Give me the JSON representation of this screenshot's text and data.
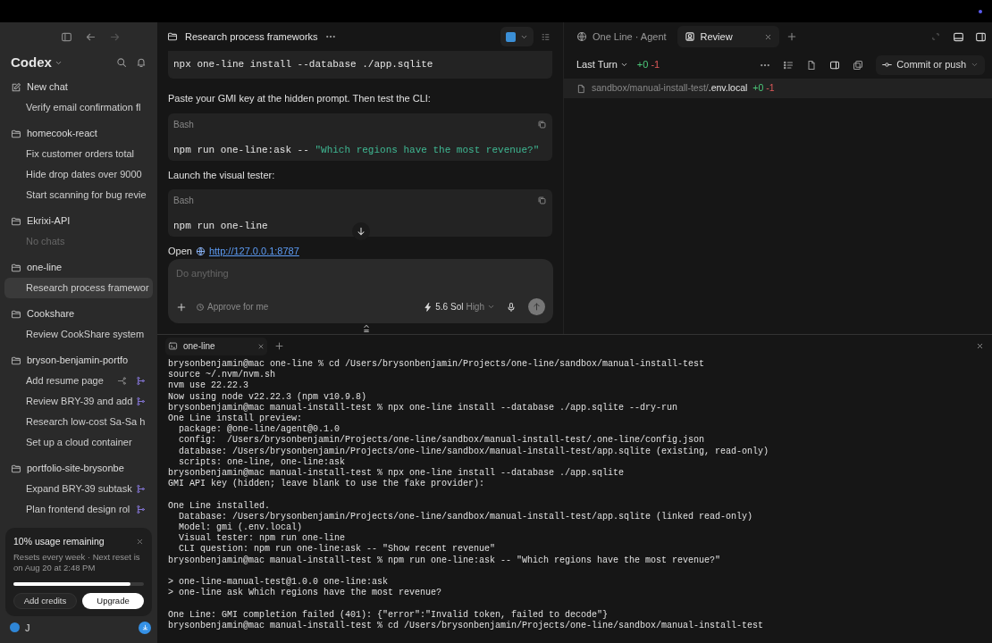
{
  "sidebar": {
    "app_title": "Codex",
    "new_chat": "New chat",
    "loose_chats": [
      {
        "title": "Verify email confirmation fl",
        "selected": false,
        "worktree": false
      }
    ],
    "projects": [
      {
        "name": "homecook-react",
        "chats": [
          {
            "title": "Fix customer orders total",
            "selected": false,
            "worktree": false
          },
          {
            "title": "Hide drop dates over 9000",
            "selected": false,
            "worktree": false
          },
          {
            "title": "Start scanning for bug revie",
            "selected": false,
            "worktree": false
          }
        ]
      },
      {
        "name": "Ekrixi-API",
        "empty_text": "No chats"
      },
      {
        "name": "one-line",
        "chats": [
          {
            "title": "Research process framewor",
            "selected": true,
            "worktree": false
          }
        ]
      },
      {
        "name": "Cookshare",
        "chats": [
          {
            "title": "Review CookShare system",
            "selected": false,
            "worktree": false
          }
        ]
      },
      {
        "name": "bryson-benjamin-portfo",
        "chats": [
          {
            "title": "Add resume page",
            "selected": false,
            "worktree": true,
            "hovered": true
          },
          {
            "title": "Review BRY-39 and add",
            "selected": false,
            "worktree": true
          },
          {
            "title": "Research low-cost Sa-Sa h",
            "selected": false,
            "worktree": false
          },
          {
            "title": "Set up a cloud container",
            "selected": false,
            "worktree": false
          }
        ]
      },
      {
        "name": "portfolio-site-brysonbe",
        "chats": [
          {
            "title": "Expand BRY-39 subtask",
            "selected": false,
            "worktree": true
          },
          {
            "title": "Plan frontend design rol",
            "selected": false,
            "worktree": true
          }
        ]
      }
    ],
    "usage": {
      "title": "10% usage remaining",
      "text": "Resets every week · Next reset is on Aug 20 at 2:48 PM",
      "level": 0.9,
      "buttons": [
        {
          "label": "Add credits",
          "kind": "secondary"
        },
        {
          "label": "Upgrade",
          "kind": "primary"
        }
      ]
    },
    "user": {
      "initial": "J"
    }
  },
  "chat": {
    "title": "Research process frameworks",
    "content": [
      {
        "kind": "code",
        "segments": [
          {
            "kind": "plain",
            "text": "npx one-line install --database ./app.sqlite"
          }
        ]
      },
      {
        "kind": "text",
        "text": "Paste your GMI key at the hidden prompt. Then test the CLI:"
      },
      {
        "kind": "code",
        "label": "Bash",
        "segments": [
          {
            "kind": "plain",
            "text": "npm run one-line:ask -- "
          },
          {
            "kind": "string",
            "text": "\"Which regions have the most revenue?\""
          }
        ]
      },
      {
        "kind": "text",
        "text": "Launch the visual tester:"
      },
      {
        "kind": "code",
        "label": "Bash",
        "segments": [
          {
            "kind": "plain",
            "text": "npm run one-line"
          }
        ]
      },
      {
        "kind": "link",
        "text": "Open",
        "url": "http://127.0.0.1:8787"
      }
    ],
    "composer": {
      "placeholder": "Do anything",
      "approval": "Approve for me",
      "model": "5.6 Sol",
      "effort": "High"
    }
  },
  "review": {
    "tabs": [
      {
        "label": "One Line · Agent",
        "selected": false,
        "kind": "web"
      },
      {
        "label": "Review",
        "selected": true,
        "kind": "review"
      }
    ],
    "scope": "Last Turn",
    "added": "+0",
    "removed": "-1",
    "commit": "Commit or push",
    "files": [
      {
        "dir": "sandbox/manual-install-test/",
        "name": ".env.local",
        "added": "+0",
        "removed": "-1"
      }
    ]
  },
  "terminal": {
    "tab": "one-line",
    "blocks": [
      [
        "brysonbenjamin@mac one-line % cd /Users/brysonbenjamin/Projects/one-line/sandbox/manual-install-test",
        "source ~/.nvm/nvm.sh",
        "nvm use 22.22.3",
        "Now using node v22.22.3 (npm v10.9.8)",
        "brysonbenjamin@mac manual-install-test % npx one-line install --database ./app.sqlite --dry-run",
        "One Line install preview:",
        "  package: @one-line/agent@0.1.0",
        "  config:  /Users/brysonbenjamin/Projects/one-line/sandbox/manual-install-test/.one-line/config.json",
        "  database: /Users/brysonbenjamin/Projects/one-line/sandbox/manual-install-test/app.sqlite (existing, read-only)",
        "  scripts: one-line, one-line:ask",
        "brysonbenjamin@mac manual-install-test % npx one-line install --database ./app.sqlite",
        "GMI API key (hidden; leave blank to use the fake provider):"
      ],
      [
        "One Line installed.",
        "  Database: /Users/brysonbenjamin/Projects/one-line/sandbox/manual-install-test/app.sqlite (linked read-only)",
        "  Model: gmi (.env.local)",
        "  Visual tester: npm run one-line",
        "  CLI question: npm run one-line:ask -- \"Show recent revenue\"",
        "brysonbenjamin@mac manual-install-test % npm run one-line:ask -- \"Which regions have the most revenue?\""
      ],
      [
        "> one-line-manual-test@1.0.0 one-line:ask",
        "> one-line ask Which regions have the most revenue?"
      ],
      [
        "One Line: GMI completion failed (401): {\"error\":\"Invalid token, failed to decode\"}",
        "brysonbenjamin@mac manual-install-test % cd /Users/brysonbenjamin/Projects/one-line/sandbox/manual-install-test"
      ]
    ]
  }
}
